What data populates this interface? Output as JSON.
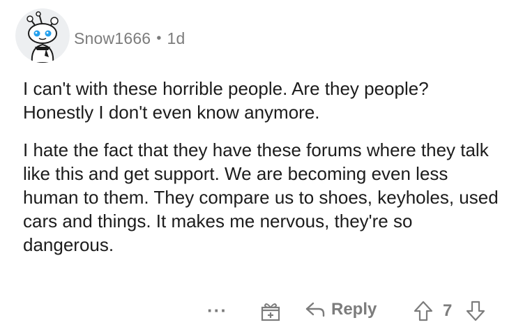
{
  "comment": {
    "author": "Snow1666",
    "separator": "•",
    "age": "1d",
    "paragraphs": [
      "I can't with these horrible people. Are they people? Honestly I don't even know anymore.",
      "I hate the fact that they have these forums where they talk like this and get support. We are becoming even less human to them. They compare us to shoes, keyholes, used cars and things. It makes me nervous, they're so dangerous."
    ]
  },
  "actions": {
    "more_label": "···",
    "award_icon": "gift-icon",
    "reply_icon": "reply-arrow-icon",
    "reply_label": "Reply",
    "upvote_icon": "upvote-arrow-icon",
    "score": "7",
    "downvote_icon": "downvote-arrow-icon"
  },
  "colors": {
    "text": "#1c1c1c",
    "meta": "#7c7c7c",
    "background": "#ffffff"
  }
}
